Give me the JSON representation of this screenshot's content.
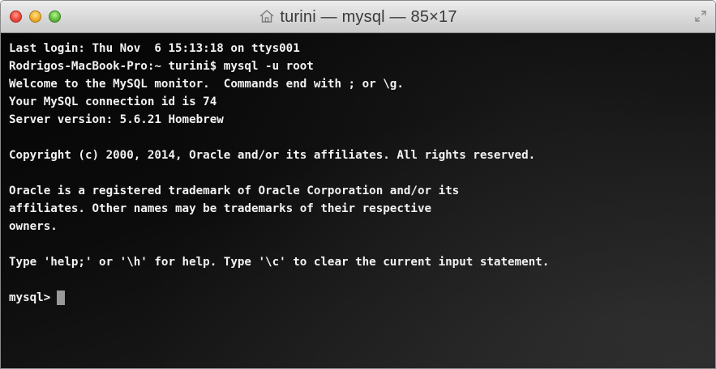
{
  "window": {
    "title": "turini — mysql — 85×17",
    "title_icon": "home-icon"
  },
  "terminal": {
    "lines": [
      "Last login: Thu Nov  6 15:13:18 on ttys001",
      "Rodrigos-MacBook-Pro:~ turini$ mysql -u root",
      "Welcome to the MySQL monitor.  Commands end with ; or \\g.",
      "Your MySQL connection id is 74",
      "Server version: 5.6.21 Homebrew",
      "",
      "Copyright (c) 2000, 2014, Oracle and/or its affiliates. All rights reserved.",
      "",
      "Oracle is a registered trademark of Oracle Corporation and/or its",
      "affiliates. Other names may be trademarks of their respective",
      "owners.",
      "",
      "Type 'help;' or '\\h' for help. Type '\\c' to clear the current input statement.",
      ""
    ],
    "prompt": "mysql>"
  },
  "colors": {
    "text": "#f2f2f2",
    "background": "#0a0a0a",
    "cursor": "#9a9a9a"
  }
}
